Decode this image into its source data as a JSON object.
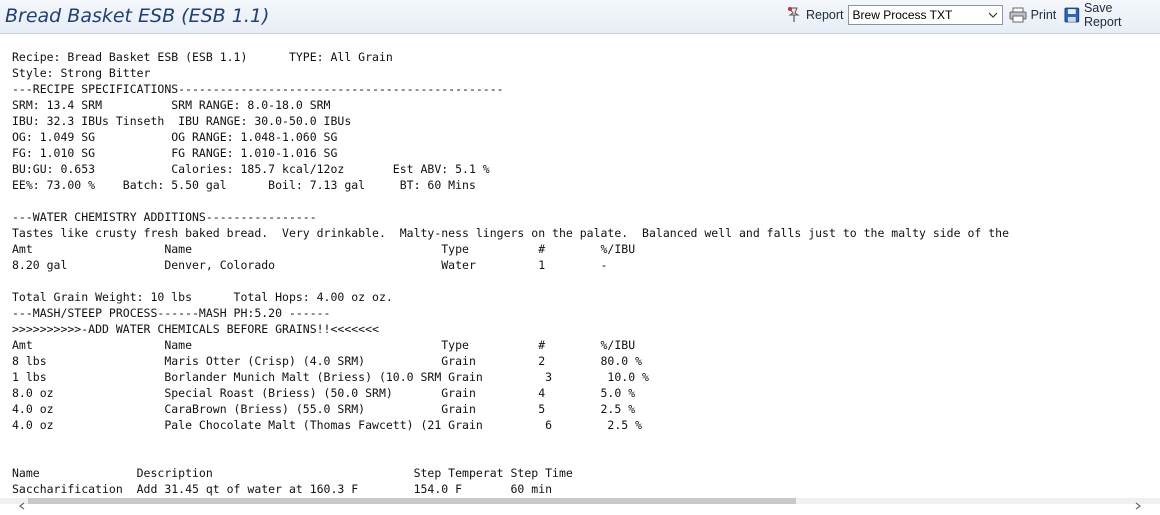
{
  "window": {
    "title": "Bread Basket ESB (ESB 1.1)"
  },
  "toolbar": {
    "report_label": "Report",
    "report_select_value": "Brew Process TXT",
    "print_label": "Print",
    "save_label": "Save Report"
  },
  "report": {
    "lines": [
      "Recipe: Bread Basket ESB (ESB 1.1)      TYPE: All Grain",
      "Style: Strong Bitter",
      "---RECIPE SPECIFICATIONS-----------------------------------------------",
      "SRM: 13.4 SRM          SRM RANGE: 8.0-18.0 SRM",
      "IBU: 32.3 IBUs Tinseth  IBU RANGE: 30.0-50.0 IBUs",
      "OG: 1.049 SG           OG RANGE: 1.048-1.060 SG",
      "FG: 1.010 SG           FG RANGE: 1.010-1.016 SG",
      "BU:GU: 0.653           Calories: 185.7 kcal/12oz       Est ABV: 5.1 %",
      "EE%: 73.00 %    Batch: 5.50 gal      Boil: 7.13 gal     BT: 60 Mins",
      "",
      "---WATER CHEMISTRY ADDITIONS----------------",
      "Tastes like crusty fresh baked bread.  Very drinkable.  Malty-ness lingers on the palate.  Balanced well and falls just to the malty side of the",
      "Amt                   Name                                    Type          #        %/IBU",
      "8.20 gal              Denver, Colorado                        Water         1        -",
      "",
      "Total Grain Weight: 10 lbs      Total Hops: 4.00 oz oz.",
      "---MASH/STEEP PROCESS------MASH PH:5.20 ------",
      ">>>>>>>>>>-ADD WATER CHEMICALS BEFORE GRAINS!!<<<<<<<",
      "Amt                   Name                                    Type          #        %/IBU",
      "8 lbs                 Maris Otter (Crisp) (4.0 SRM)           Grain         2        80.0 %",
      "1 lbs                 Borlander Munich Malt (Briess) (10.0 SRM Grain         3        10.0 %",
      "8.0 oz                Special Roast (Briess) (50.0 SRM)       Grain         4        5.0 %",
      "4.0 oz                CaraBrown (Briess) (55.0 SRM)           Grain         5        2.5 %",
      "4.0 oz                Pale Chocolate Malt (Thomas Fawcett) (21 Grain         6        2.5 %",
      "",
      "",
      "Name              Description                             Step Temperat Step Time",
      "Saccharification  Add 31.45 qt of water at 160.3 F        154.0 F       60 min"
    ]
  }
}
